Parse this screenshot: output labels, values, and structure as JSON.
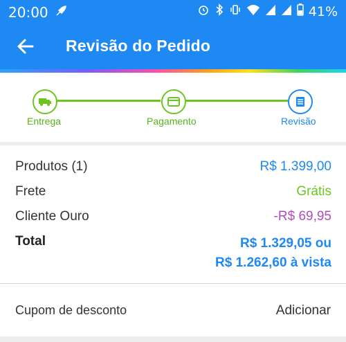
{
  "status_bar": {
    "time": "20:00",
    "battery": "41%"
  },
  "app_bar": {
    "title": "Revisão do Pedido"
  },
  "steps": [
    {
      "label": "Entrega",
      "state": "done"
    },
    {
      "label": "Pagamento",
      "state": "done"
    },
    {
      "label": "Revisão",
      "state": "current"
    }
  ],
  "summary": {
    "produtos_label": "Produtos (1)",
    "produtos_value": "R$ 1.399,00",
    "frete_label": "Frete",
    "frete_value": "Grátis",
    "cliente_label": "Cliente Ouro",
    "cliente_value": "-R$ 69,95",
    "total_label": "Total",
    "total_value_1": "R$ 1.329,05 ou",
    "total_value_2": "R$ 1.262,60 à vista"
  },
  "coupon": {
    "label": "Cupom de desconto",
    "action": "Adicionar"
  },
  "colors": {
    "primary": "#1e88f3",
    "success": "#6cc51f",
    "discount": "#b04eb8"
  }
}
